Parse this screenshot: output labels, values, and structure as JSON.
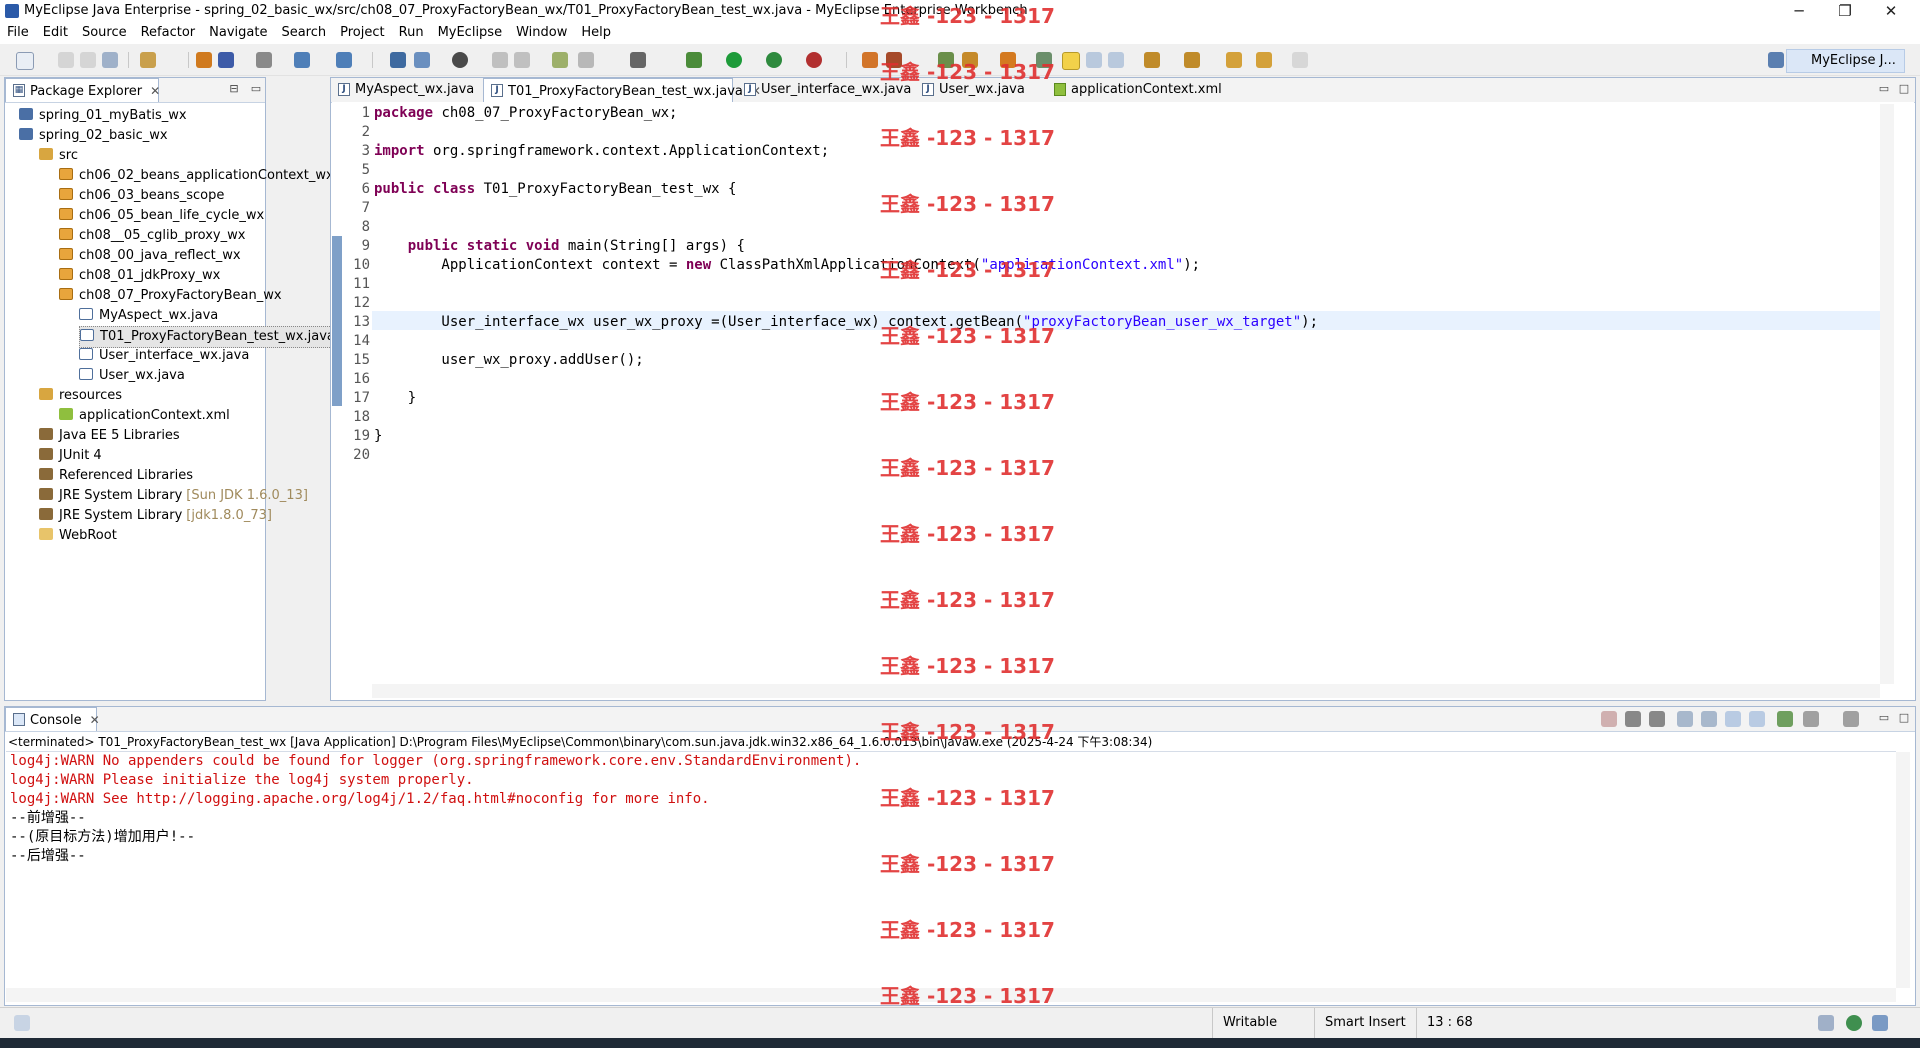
{
  "window": {
    "title": "MyEclipse Java Enterprise - spring_02_basic_wx/src/ch08_07_ProxyFactoryBean_wx/T01_ProxyFactoryBean_test_wx.java - MyEclipse Enterprise Workbench",
    "minimize": "─",
    "restore": "❐",
    "close": "✕"
  },
  "menu": [
    "File",
    "Edit",
    "Source",
    "Refactor",
    "Navigate",
    "Search",
    "Project",
    "Run",
    "MyEclipse",
    "Window",
    "Help"
  ],
  "perspective": {
    "label": "MyEclipse J..."
  },
  "package_explorer": {
    "title": "Package Explorer",
    "close": "✕",
    "tree": [
      {
        "label": "spring_01_myBatis_wx",
        "icon": "project-icon"
      },
      {
        "label": "spring_02_basic_wx",
        "icon": "project-icon"
      },
      {
        "label": "src",
        "icon": "source-folder-icon"
      },
      {
        "label": "ch06_02_beans_applicationContext_wx",
        "icon": "package-icon"
      },
      {
        "label": "ch06_03_beans_scope",
        "icon": "package-icon"
      },
      {
        "label": "ch06_05_bean_life_cycle_wx",
        "icon": "package-icon"
      },
      {
        "label": "ch08__05_cglib_proxy_wx",
        "icon": "package-icon"
      },
      {
        "label": "ch08_00_java_reflect_wx",
        "icon": "package-icon"
      },
      {
        "label": "ch08_01_jdkProxy_wx",
        "icon": "package-icon"
      },
      {
        "label": "ch08_07_ProxyFactoryBean_wx",
        "icon": "package-icon"
      },
      {
        "label": "MyAspect_wx.java",
        "icon": "java-file-icon"
      },
      {
        "label": "T01_ProxyFactoryBean_test_wx.java",
        "icon": "java-file-icon",
        "selected": true
      },
      {
        "label": "User_interface_wx.java",
        "icon": "java-file-icon"
      },
      {
        "label": "User_wx.java",
        "icon": "java-file-icon"
      },
      {
        "label": "resources",
        "icon": "source-folder-icon"
      },
      {
        "label": "applicationContext.xml",
        "icon": "xml-file-icon"
      },
      {
        "label": "Java EE 5 Libraries",
        "icon": "library-icon"
      },
      {
        "label": "JUnit 4",
        "icon": "library-icon"
      },
      {
        "label": "Referenced Libraries",
        "icon": "library-icon"
      },
      {
        "label": "JRE System Library",
        "deco": "[Sun JDK 1.6.0_13]",
        "icon": "library-icon"
      },
      {
        "label": "JRE System Library",
        "deco": "[jdk1.8.0_73]",
        "icon": "library-icon"
      },
      {
        "label": "WebRoot",
        "icon": "folder-icon"
      }
    ]
  },
  "editor": {
    "tabs": [
      {
        "label": "MyAspect_wx.java",
        "active": false
      },
      {
        "label": "T01_ProxyFactoryBean_test_wx.java",
        "active": true,
        "close": "✕"
      },
      {
        "label": "User_interface_wx.java",
        "active": false
      },
      {
        "label": "User_wx.java",
        "active": false
      },
      {
        "label": "applicationContext.xml",
        "active": false
      }
    ],
    "line_numbers": [
      "1",
      "2",
      "3",
      "5",
      "6",
      "7",
      "8",
      "9",
      "10",
      "11",
      "12",
      "13",
      "14",
      "15",
      "16",
      "17",
      "18",
      "19",
      "20"
    ],
    "lines": {
      "l1_kw": "package",
      "l1_rest": " ch08_07_ProxyFactoryBean_wx;",
      "l3_kw": "import",
      "l3_rest": " org.springframework.context.ApplicationContext;",
      "l6_kw": "public class",
      "l6_rest": " T01_ProxyFactoryBean_test_wx {",
      "l9_kw": "    public static void",
      "l9_rest": " main(String[] args) {",
      "l10_a": "        ApplicationContext context = ",
      "l10_kw": "new",
      "l10_b": " ClassPathXmlApplicationContext(",
      "l10_str": "\"applicationContext.xml\"",
      "l10_c": ");",
      "l13_a": "        User_interface_wx user_wx_proxy =(User_interface_wx) context.getBean(",
      "l13_str": "\"proxyFactoryBean_user_wx_target\"",
      "l13_c": ");",
      "l15": "        user_wx_proxy.addUser();",
      "l17": "    }",
      "l19": "}"
    }
  },
  "console": {
    "title": "Console",
    "close": "✕",
    "terminated": "<terminated> T01_ProxyFactoryBean_test_wx [Java Application] D:\\Program Files\\MyEclipse\\Common\\binary\\com.sun.java.jdk.win32.x86_64_1.6.0.013\\bin\\javaw.exe (2025-4-24 下午3:08:34)",
    "output": [
      {
        "text": "log4j:WARN No appenders could be found for logger (org.springframework.core.env.StandardEnvironment).",
        "type": "err"
      },
      {
        "text": "log4j:WARN Please initialize the log4j system properly.",
        "type": "err"
      },
      {
        "text": "log4j:WARN See http://logging.apache.org/log4j/1.2/faq.html#noconfig for more info.",
        "type": "err"
      },
      {
        "text": "--前增强--",
        "type": "out"
      },
      {
        "text": "--(原目标方法)增加用户!--",
        "type": "out"
      },
      {
        "text": "--后增强--",
        "type": "out"
      }
    ]
  },
  "status": {
    "writable": "Writable",
    "insert_mode": "Smart Insert",
    "position": "13 : 68"
  },
  "watermark": "王鑫 -123 - 1317",
  "colors": {
    "keyword": "#7f0055",
    "string": "#2a00ff",
    "error": "#d01010",
    "watermark": "#e03030"
  }
}
